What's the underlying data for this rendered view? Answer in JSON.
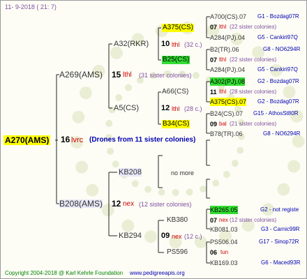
{
  "header": {
    "date_text": "11-  9-2018 (  21:  7)"
  },
  "root": {
    "id": "A270(AMS)",
    "gen": "16",
    "yard": "lvrc",
    "note": "(Drones from 11 sister colonies)"
  },
  "gen1": [
    {
      "id": "A269(AMS)",
      "gen": "15",
      "yard": "lthl",
      "note": "(31 sister colonies)"
    },
    {
      "id": "B208(AMS)",
      "gen": "12",
      "yard": "nex",
      "note": "(12 sister colonies)"
    }
  ],
  "gen2": [
    {
      "id": "A32(RKR)",
      "gen": "10",
      "yard": "lthl",
      "note": "(32 c.)"
    },
    {
      "id": "A5(CS)",
      "gen": "12",
      "yard": "lthl",
      "note": "(28 c.)"
    },
    {
      "id": "KB208",
      "extra": "no more"
    },
    {
      "id": "KB294",
      "gen": "09",
      "yard": "nex",
      "note": "(12 c.)"
    }
  ],
  "gen3": [
    {
      "id": "A375(CS)"
    },
    {
      "id": "B25(CS)"
    },
    {
      "id": "A66(CS)"
    },
    {
      "id": "B34(CS)"
    },
    {
      "id": "KB380"
    },
    {
      "id": "PS596"
    }
  ],
  "gen4": [
    {
      "id": "A700(CS).07",
      "ref": "G1 - Bozdag07R"
    },
    {
      "gen": "07",
      "yard": "lthl",
      "note": "(22 sister colonies)"
    },
    {
      "id": "A284(PJ).04",
      "ref": "G5 - Cankiri97Q"
    },
    {
      "id": "B2(TR).06",
      "ref": "G8 - NO6294R"
    },
    {
      "gen": "07",
      "yard": "lthl",
      "note": "(22 sister colonies)"
    },
    {
      "id": "A284(PJ).04",
      "ref": "G5 - Cankiri97Q"
    },
    {
      "id": "A302(PJ).08",
      "ref": "G2 - Bozdag07R"
    },
    {
      "gen": "11",
      "yard": "lthl",
      "note": "(28 sister colonies)"
    },
    {
      "id": "A375(CS).07",
      "ref": "G2 - Bozdag07R"
    },
    {
      "id": "B24(CS).07",
      "ref": "G15 - AthosSt80R"
    },
    {
      "gen": "09",
      "yard": "bal",
      "note": "(21 sister colonies)"
    },
    {
      "id": "B78(TR).06",
      "ref": "G8 - NO6294R"
    },
    {
      "id": "KB265.05",
      "ref": "G2 - not registe"
    },
    {
      "gen": "07",
      "yard": "nex",
      "note": "(12 sister colonies)"
    },
    {
      "id": "KB081.03",
      "ref": "G3 - Carnic99R"
    },
    {
      "id": "PS506.04",
      "ref": "G17 - Sinop72R"
    },
    {
      "gen": "06",
      "yard": "tun",
      "note": ""
    },
    {
      "id": "KB169.03",
      "ref": "G6 - Maced93R"
    }
  ],
  "footer": {
    "copyright": "Copyright 2004-2018 @ Karl Kehrle Foundation",
    "url": "www.pedigreeapis.org"
  }
}
